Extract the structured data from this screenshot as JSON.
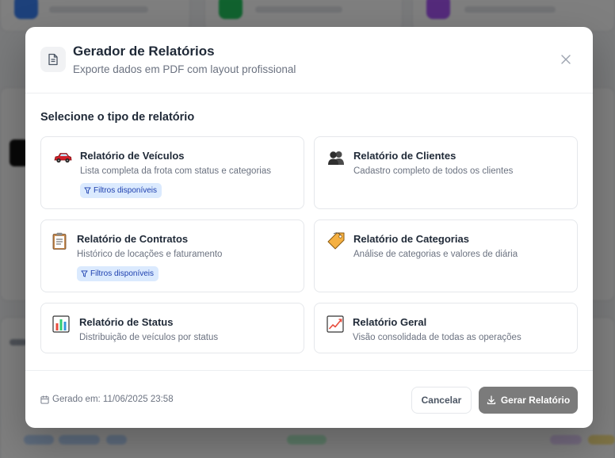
{
  "modal": {
    "title": "Gerador de Relatórios",
    "subtitle": "Exporte dados em PDF com layout profissional",
    "section_title": "Selecione o tipo de relatório",
    "report_types": [
      {
        "icon": "car-icon",
        "emoji": "🚗",
        "title": "Relatório de Veículos",
        "description": "Lista completa da frota com status e categorias",
        "badge": "Filtros disponíveis"
      },
      {
        "icon": "people-icon",
        "emoji": "👥",
        "title": "Relatório de Clientes",
        "description": "Cadastro completo de todos os clientes"
      },
      {
        "icon": "clipboard-icon",
        "emoji": "📋",
        "title": "Relatório de Contratos",
        "description": "Histórico de locações e faturamento",
        "badge": "Filtros disponíveis"
      },
      {
        "icon": "tag-icon",
        "emoji": "🏷️",
        "title": "Relatório de Categorias",
        "description": "Análise de categorias e valores de diária"
      },
      {
        "icon": "bar-chart-icon",
        "emoji": "📊",
        "title": "Relatório de Status",
        "description": "Distribuição de veículos por status"
      },
      {
        "icon": "line-chart-icon",
        "emoji": "📈",
        "title": "Relatório Geral",
        "description": "Visão consolidada de todas as operações"
      }
    ],
    "footer": {
      "generated_label": "Gerado em: 11/06/2025 23:58",
      "cancel_label": "Cancelar",
      "generate_label": "Gerar Relatório"
    }
  },
  "colors": {
    "badge_bg": "#dbeafe",
    "badge_text": "#1e40af",
    "primary_button": "#7b7b7b"
  }
}
